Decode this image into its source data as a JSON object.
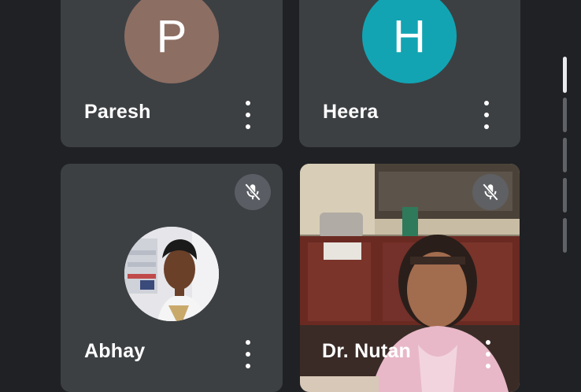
{
  "participants": [
    {
      "name": "Paresh",
      "initial": "P",
      "avatar_color": "#8d6e63"
    },
    {
      "name": "Heera",
      "initial": "H",
      "avatar_color": "#12a4b3"
    },
    {
      "name": "Abhay",
      "muted": true
    },
    {
      "name": "Dr. Nutan",
      "muted": true
    }
  ],
  "icons": {
    "more": "more-options-icon",
    "mute": "mic-off-icon"
  },
  "colors": {
    "background": "#202124",
    "tile": "#3c4043"
  }
}
